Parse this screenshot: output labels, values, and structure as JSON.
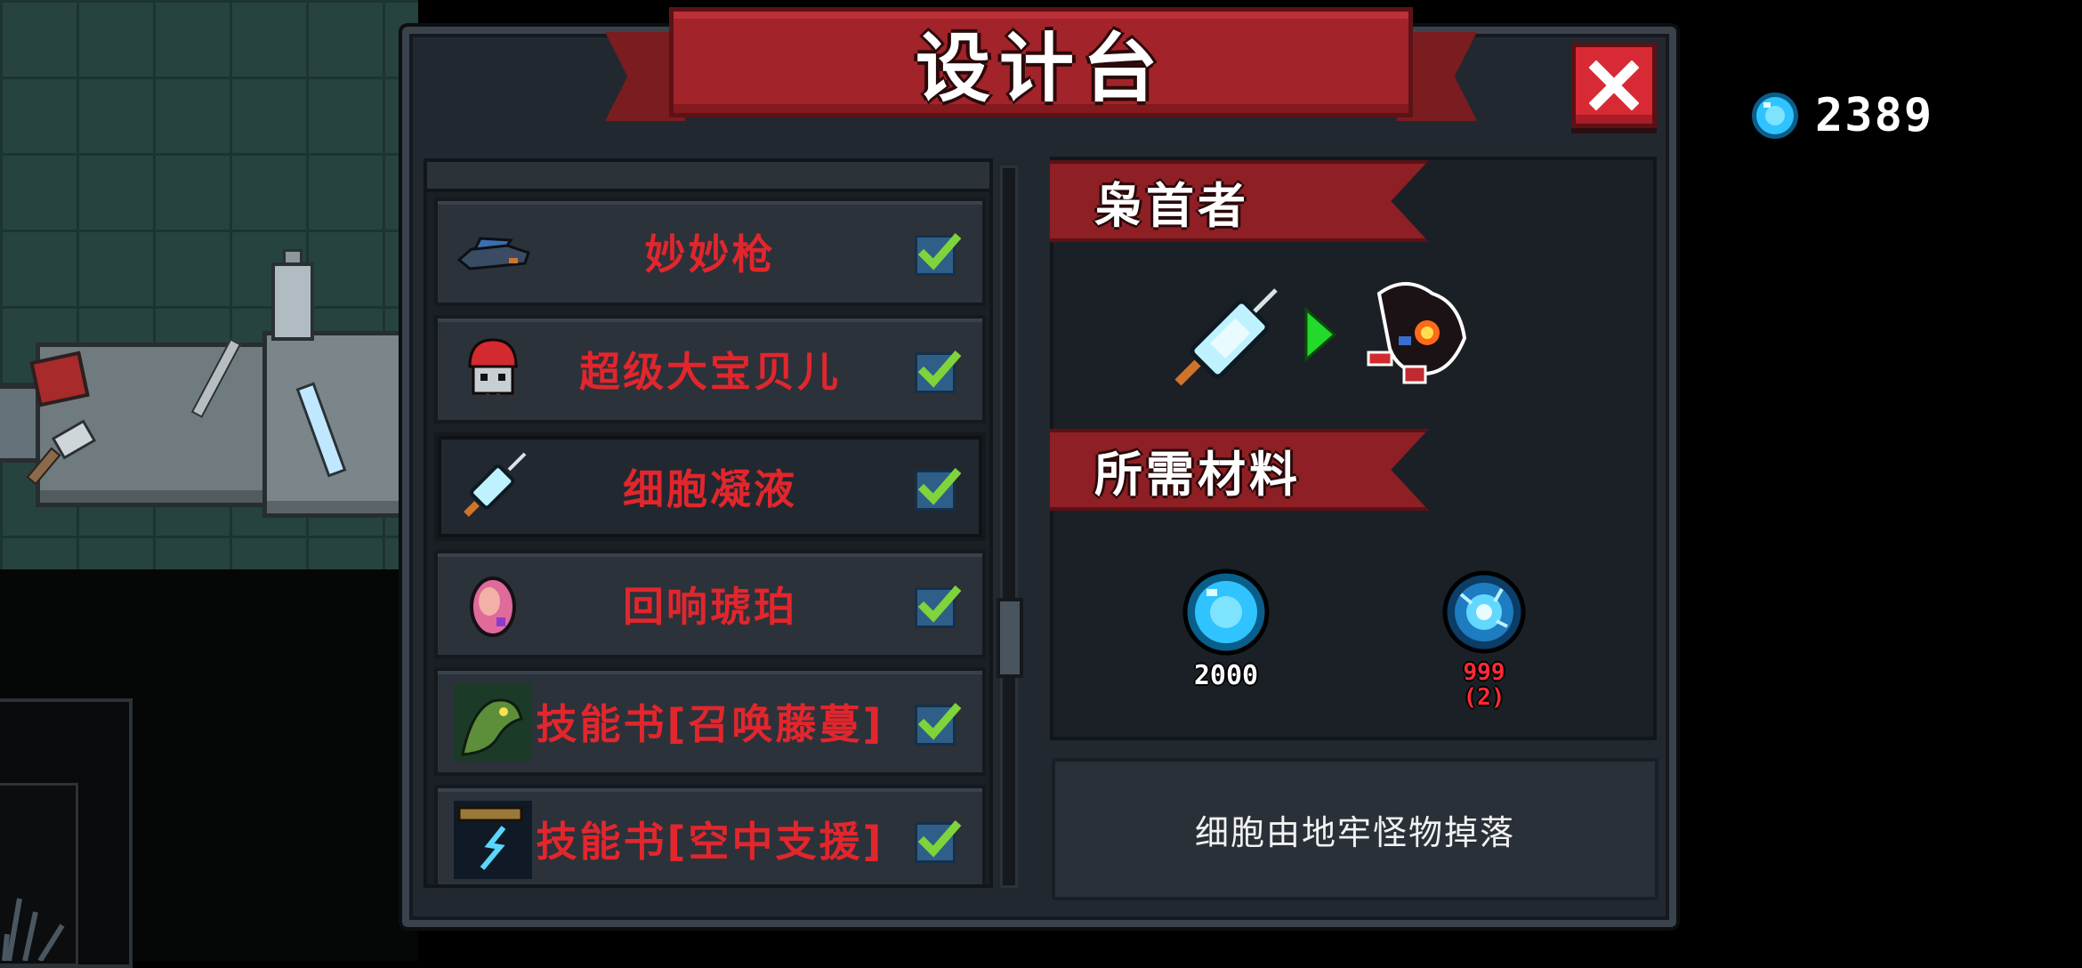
{
  "window": {
    "title": "设计台"
  },
  "currency": {
    "icon": "blue-gem-icon",
    "value": "2389"
  },
  "list": {
    "items": [
      {
        "label": "妙妙枪",
        "icon": "gun-icon",
        "checked": true,
        "selected": false
      },
      {
        "label": "超级大宝贝儿",
        "icon": "red-helmet-robot-icon",
        "checked": true,
        "selected": false
      },
      {
        "label": "细胞凝液",
        "icon": "syringe-icon",
        "checked": true,
        "selected": true
      },
      {
        "label": "回响琥珀",
        "icon": "amber-gem-icon",
        "checked": true,
        "selected": false
      },
      {
        "label": "技能书[召唤藤蔓]",
        "icon": "vine-monster-icon",
        "checked": true,
        "selected": false
      },
      {
        "label": "技能书[空中支援]",
        "icon": "air-support-icon",
        "checked": true,
        "selected": false
      }
    ]
  },
  "detail": {
    "weapon_name": "枭首者",
    "materials_heading": "所需材料",
    "materials": [
      {
        "icon": "blue-gem-icon",
        "label": "2000",
        "color": "#ffffff"
      },
      {
        "icon": "cell-orb-icon",
        "label": "999",
        "sublabel": "(2)",
        "color": "#ff2a36"
      }
    ],
    "description": "细胞由地牢怪物掉落"
  },
  "colors": {
    "ribbon": "#a3232a",
    "list_text": "#e1262d",
    "check": "#7ed43a",
    "arrow": "#23d92b"
  }
}
